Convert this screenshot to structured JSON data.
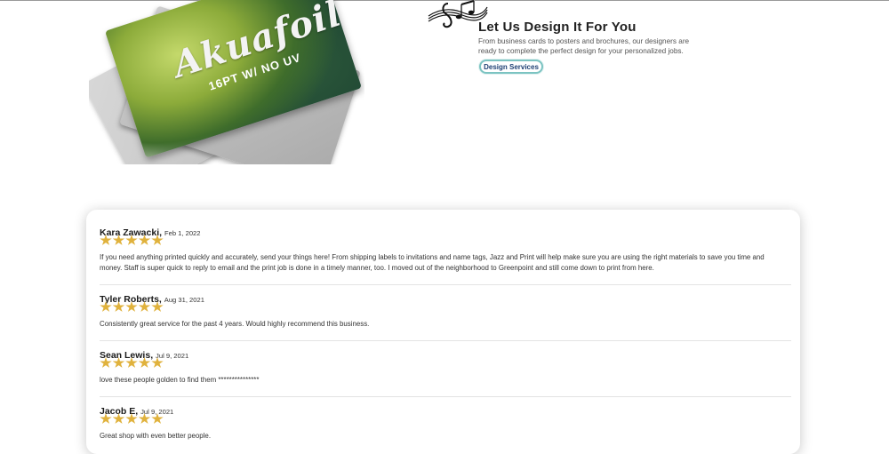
{
  "promo": {
    "card_brand": "Akuafoil",
    "card_spec": "16PT W/ NO UV"
  },
  "design_services": {
    "title": "Let Us Design It For You",
    "description": "From business cards to posters and brochures, our designers are ready to complete the perfect design for your personalized jobs.",
    "button_label": "Design Services",
    "accent_color": "#7cc4c2"
  },
  "reviews": {
    "star_color": "#e0b23d",
    "items": [
      {
        "name": "Kara Zawacki",
        "date": "Feb 1, 2022",
        "rating": 5,
        "text": "If you need anything printed quickly and accurately, send your things here! From shipping labels to invitations and name tags, Jazz and Print will help make sure you are using the right materials to save you time and money. Staff is super quick to reply to email and the print job is done in a timely manner, too. I moved out of the neighborhood to Greenpoint and still come down to print from here."
      },
      {
        "name": "Tyler Roberts",
        "date": "Aug 31, 2021",
        "rating": 5,
        "text": "Consistently great service for the past 4 years. Would highly recommend this business."
      },
      {
        "name": "Sean Lewis",
        "date": "Jul 9, 2021",
        "rating": 5,
        "text": "love these people golden to find them ***************"
      },
      {
        "name": "Jacob E",
        "date": "Jul 9, 2021",
        "rating": 5,
        "text": "Great shop with even better people."
      }
    ]
  }
}
